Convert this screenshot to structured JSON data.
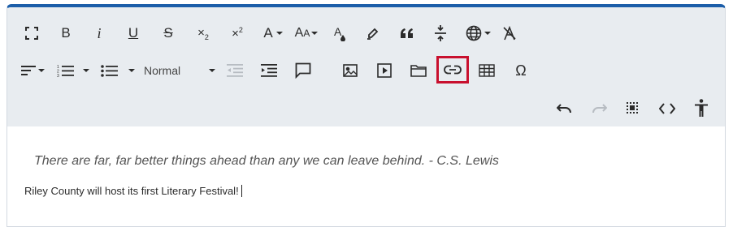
{
  "toolbar": {
    "format_select": {
      "value": "Normal"
    },
    "row1": [
      "fullscreen",
      "bold",
      "italic",
      "underline",
      "strikethrough",
      "subscript",
      "superscript",
      "font-color",
      "font-size",
      "text-background-color",
      "highlighter",
      "quote",
      "horizontal-rule",
      "language",
      "remove-format"
    ],
    "row2": [
      "align",
      "ordered-list",
      "unordered-list",
      "format",
      "outdent",
      "indent",
      "comment",
      "image",
      "media",
      "file",
      "insert-link",
      "table",
      "special-character"
    ],
    "row3": [
      "undo",
      "redo",
      "select-all",
      "source-code",
      "accessibility-checker"
    ],
    "highlighted": "insert-link",
    "highlight_color": "#c8102e",
    "accent_color": "#1c5ea9"
  },
  "content": {
    "quote": "There are far, far better things ahead than any we can leave behind. - C.S. Lewis",
    "paragraph": "Riley County will host its first Literary Festival!"
  }
}
